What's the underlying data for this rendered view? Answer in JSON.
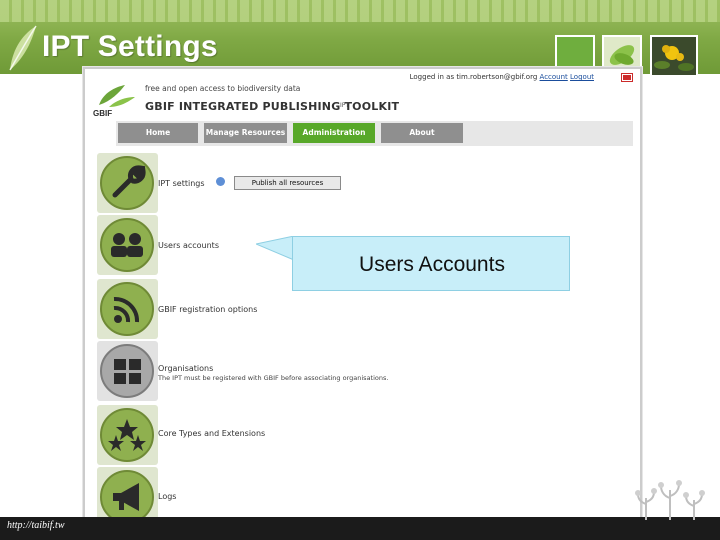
{
  "slide": {
    "title": "IPT Settings",
    "footer_url": "http://taibif.tw"
  },
  "app": {
    "login_text": "Logged in as tim.robertson@gbif.org",
    "account_link": "Account",
    "logout_link": "Logout",
    "brand_tagline": "free and open access to biodiversity data",
    "brand_title": "GBIF INTEGRATED PUBLISHING TOOLKIT",
    "brand_sup": "IPT",
    "logo_text": "GBIF",
    "nav": [
      {
        "label": "Home",
        "active": false
      },
      {
        "label": "Manage Resources",
        "active": false
      },
      {
        "label": "Administration",
        "active": true
      },
      {
        "label": "About",
        "active": false
      }
    ],
    "settings_rows": [
      {
        "label": "IPT settings",
        "icon": "wrench-icon"
      },
      {
        "label": "Users accounts",
        "icon": "users-icon"
      },
      {
        "label": "GBIF registration options",
        "icon": "rss-icon"
      },
      {
        "label": "Organisations",
        "icon": "organisation-icon"
      },
      {
        "label": "Core Types and Extensions",
        "icon": "stars-icon"
      },
      {
        "label": "Logs",
        "icon": "megaphone-icon"
      }
    ],
    "organisations_note": "The IPT must be registered with GBIF before associating organisations.",
    "publish_button": "Publish all resources"
  },
  "callout": {
    "text": "Users Accounts"
  },
  "colors": {
    "header_green": "#7fa844",
    "nav_active": "#58a829",
    "nav_inactive": "#8f8f8f",
    "callout_bg": "#c8eef9",
    "icon_green": "#8fb04f"
  }
}
